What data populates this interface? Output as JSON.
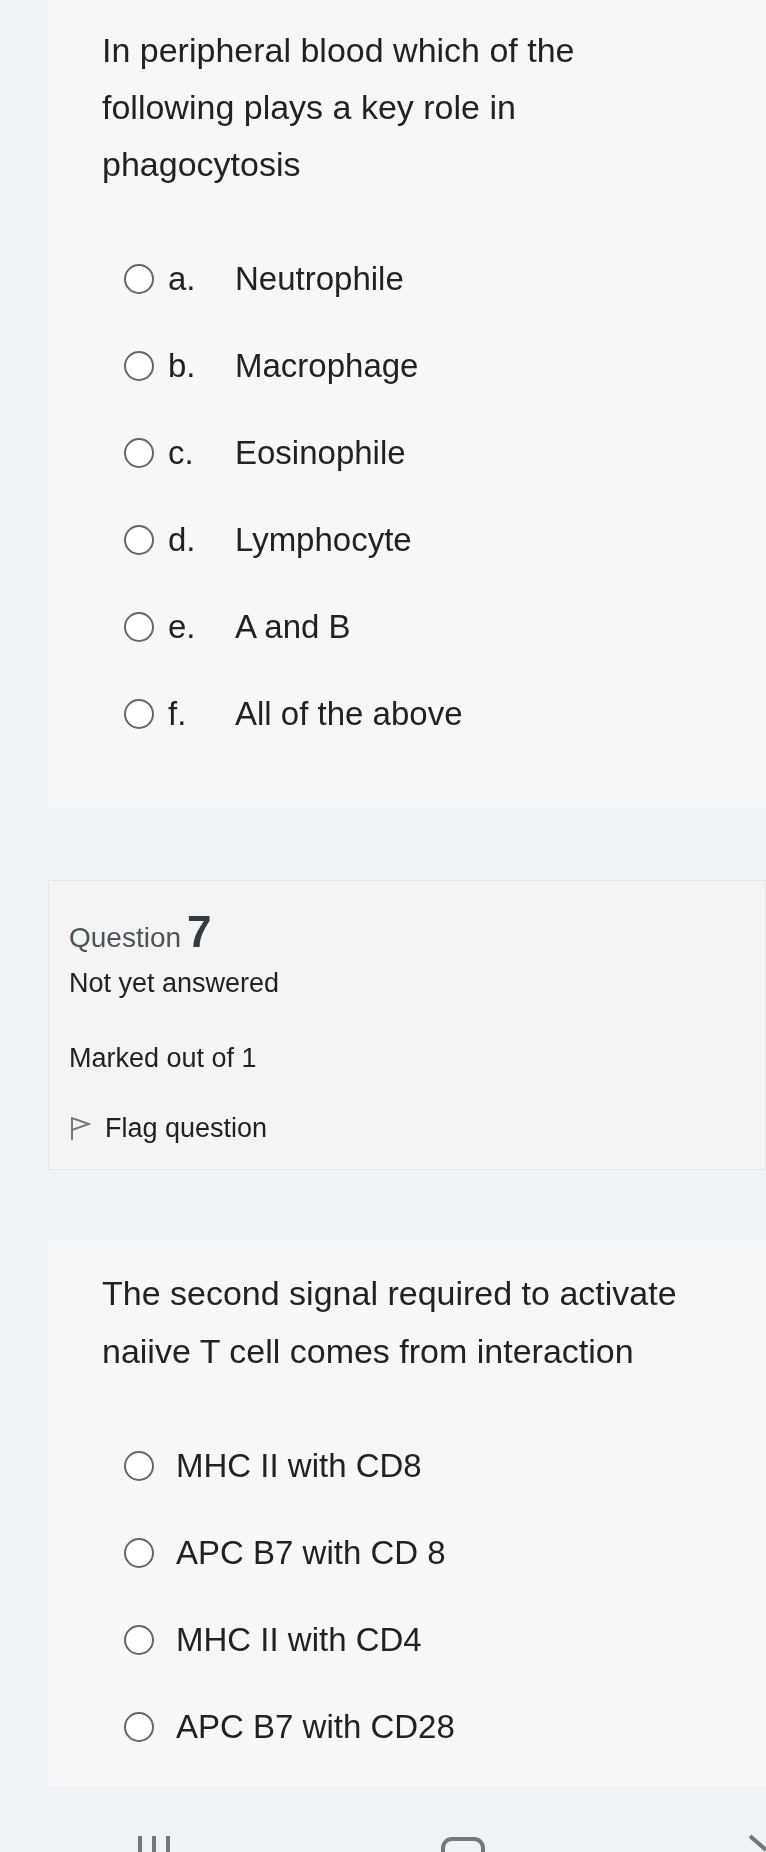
{
  "question_6": {
    "text": "In peripheral blood which of the following plays a key role in phagocytosis",
    "options": [
      {
        "letter": "a.",
        "label": "Neutrophile",
        "selected": false
      },
      {
        "letter": "b.",
        "label": "Macrophage",
        "selected": false
      },
      {
        "letter": "c.",
        "label": "Eosinophile",
        "selected": false
      },
      {
        "letter": "d.",
        "label": "Lymphocyte",
        "selected": false
      },
      {
        "letter": "e.",
        "label": "A and B",
        "selected": false
      },
      {
        "letter": "f.",
        "label": "All of the above",
        "selected": false
      }
    ]
  },
  "question_7_info": {
    "label": "Question",
    "number": "7",
    "status": "Not yet answered",
    "marks": "Marked out of 1",
    "flag": "Flag question"
  },
  "question_7": {
    "text": "The second signal required to activate naiive T cell comes from interaction",
    "options": [
      {
        "label": "MHC II with CD8",
        "selected": false
      },
      {
        "label": "APC B7 with CD 8",
        "selected": false
      },
      {
        "label": "MHC II with CD4",
        "selected": false
      },
      {
        "label": "APC B7 with CD28",
        "selected": false
      }
    ]
  }
}
